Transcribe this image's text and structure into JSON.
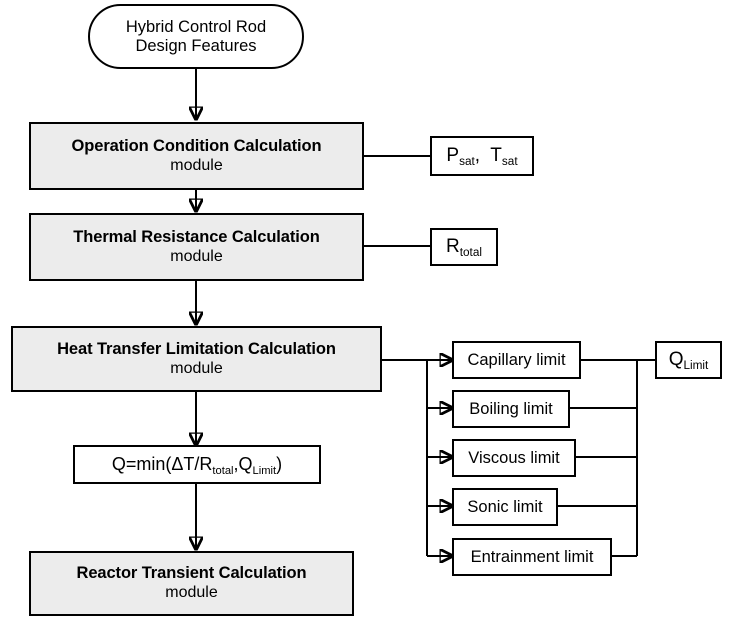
{
  "diagram": {
    "title_node": {
      "line1": "Hybrid Control Rod",
      "line2": "Design Features"
    },
    "modules": [
      {
        "title": "Operation Condition Calculation",
        "sub": "module"
      },
      {
        "title": "Thermal Resistance Calculation",
        "sub": "module"
      },
      {
        "title": "Heat Transfer Limitation Calculation",
        "sub": "module"
      },
      {
        "title": "Reactor Transient Calculation",
        "sub": "module"
      }
    ],
    "outputs": {
      "saturation": "P<sub>sat</sub>,&nbsp; T<sub>sat</sub>",
      "saturation_plain": "P_sat, T_sat",
      "resistance": "R<sub>total</sub>",
      "resistance_plain": "R_total",
      "q_limit": "Q<sub>Limit</sub>",
      "q_limit_plain": "Q_Limit"
    },
    "limits": [
      "Capillary limit",
      "Boiling limit",
      "Viscous limit",
      "Sonic limit",
      "Entrainment limit"
    ],
    "formula": "Q=min(&Delta;T/R<sub>total</sub>,Q<sub>Limit</sub>)",
    "formula_plain": "Q=min(ΔT/R_total,Q_Limit)",
    "colors": {
      "module_fill": "#ececec",
      "box_fill": "#ffffff",
      "stroke": "#000000",
      "background": "#ffffff"
    }
  }
}
